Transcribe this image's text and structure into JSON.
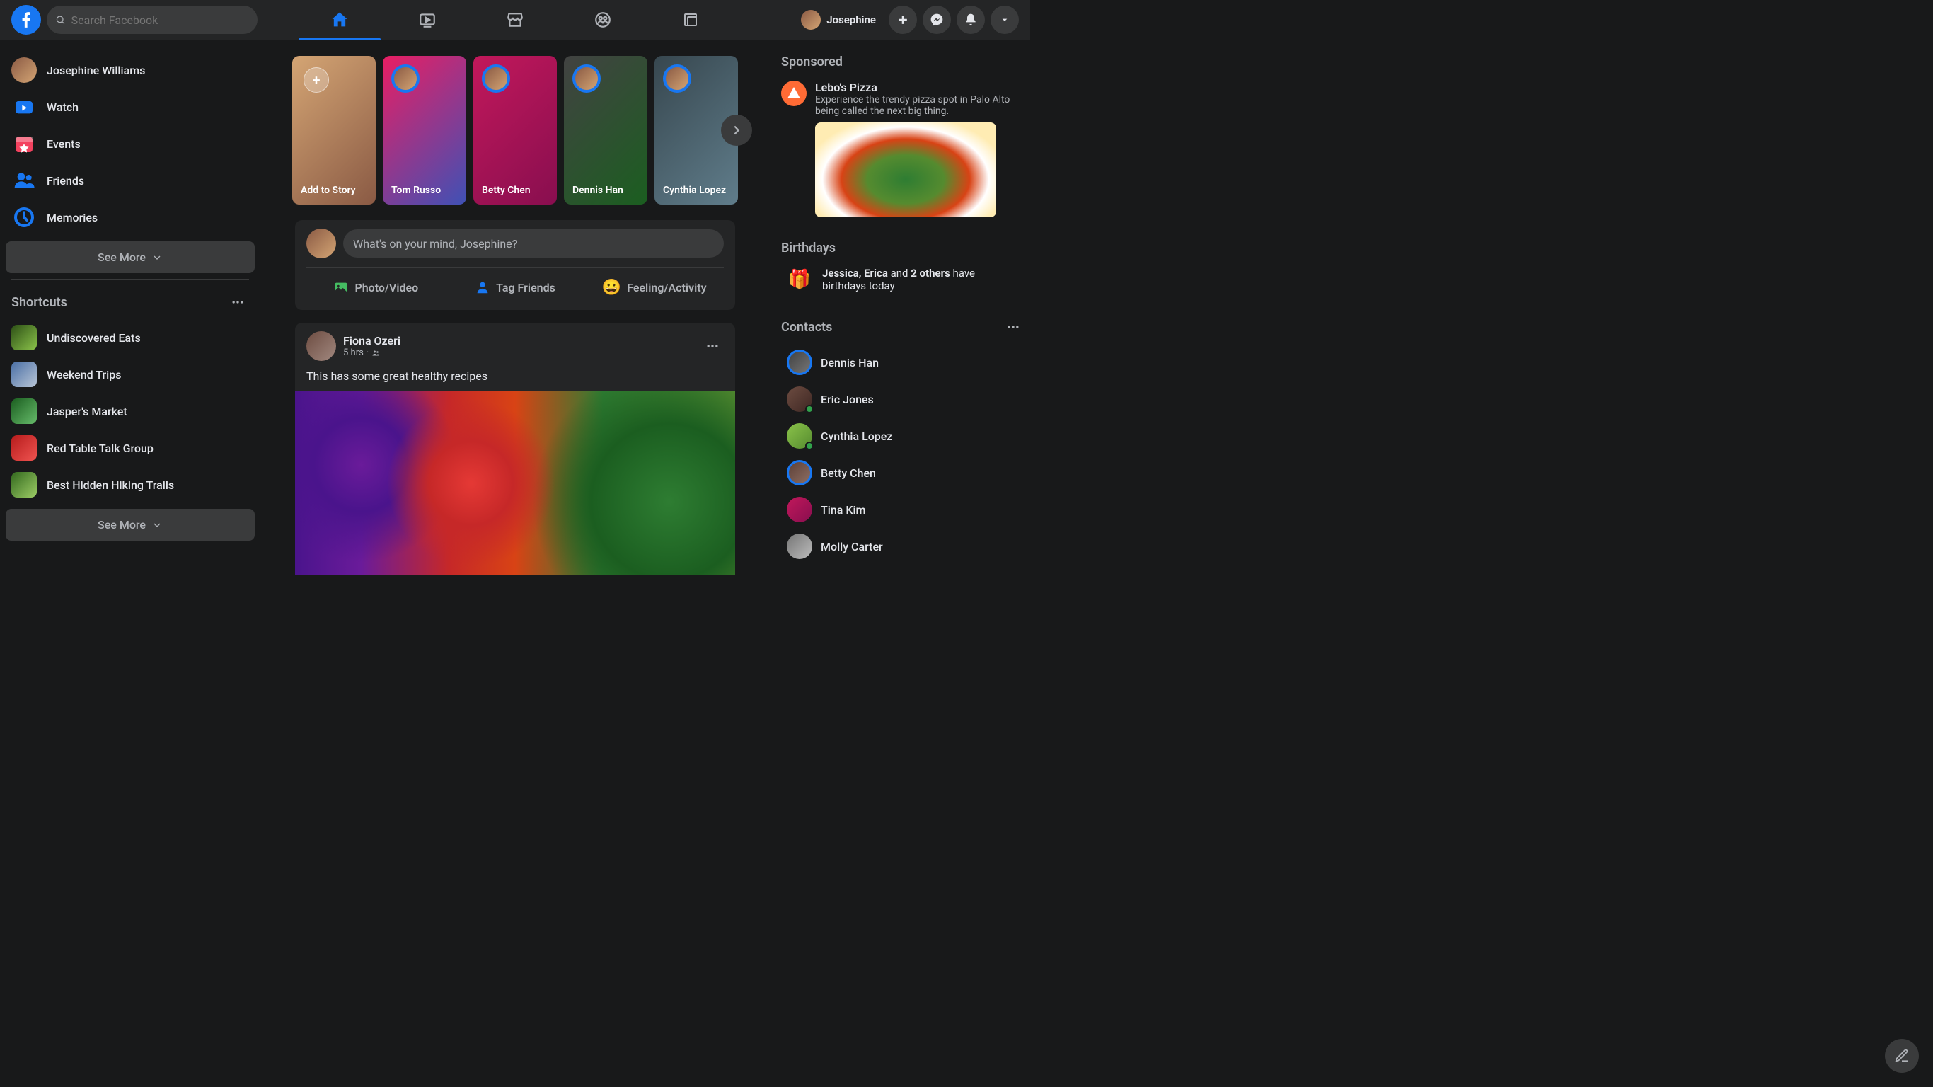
{
  "header": {
    "search_placeholder": "Search Facebook",
    "user_name": "Josephine"
  },
  "left_nav": {
    "profile_name": "Josephine Williams",
    "items": [
      {
        "label": "Watch",
        "icon": "watch",
        "color": "#1877f2"
      },
      {
        "label": "Events",
        "icon": "events",
        "color": "#f3425f"
      },
      {
        "label": "Friends",
        "icon": "friends",
        "color": "#1877f2"
      },
      {
        "label": "Memories",
        "icon": "memories",
        "color": "#1877f2"
      }
    ],
    "see_more": "See More",
    "shortcuts_title": "Shortcuts",
    "shortcuts": [
      {
        "label": "Undiscovered Eats",
        "bg": "linear-gradient(135deg,#2d5016,#8bc34a)"
      },
      {
        "label": "Weekend Trips",
        "bg": "linear-gradient(135deg,#4a6fa5,#b8c5d6)"
      },
      {
        "label": "Jasper's Market",
        "bg": "linear-gradient(135deg,#1b5e20,#66bb6a)"
      },
      {
        "label": "Red Table Talk Group",
        "bg": "linear-gradient(135deg,#b71c1c,#ef5350)"
      },
      {
        "label": "Best Hidden Hiking Trails",
        "bg": "linear-gradient(135deg,#33691e,#9ccc65)"
      }
    ]
  },
  "stories": [
    {
      "label": "Add to Story",
      "type": "add",
      "bg": "linear-gradient(135deg,#d4a574,#8a5a44)"
    },
    {
      "label": "Tom Russo",
      "bg": "linear-gradient(135deg,#e91e63,#3f51b5)"
    },
    {
      "label": "Betty Chen",
      "bg": "linear-gradient(135deg,#c2185b,#880e4f)"
    },
    {
      "label": "Dennis Han",
      "bg": "linear-gradient(135deg,#424242,#1b5e20)"
    },
    {
      "label": "Cynthia Lopez",
      "bg": "linear-gradient(135deg,#37474f,#607d8b)"
    }
  ],
  "composer": {
    "placeholder": "What's on your mind, Josephine?",
    "photo_video": "Photo/Video",
    "tag_friends": "Tag Friends",
    "feeling": "Feeling/Activity"
  },
  "post": {
    "author": "Fiona Ozeri",
    "time": "5 hrs",
    "text": "This has some great healthy recipes"
  },
  "right": {
    "sponsored_title": "Sponsored",
    "sponsor": {
      "title": "Lebo's Pizza",
      "desc": "Experience the trendy pizza spot in Palo Alto being called the next big thing."
    },
    "birthdays_title": "Birthdays",
    "birthday_text_1": "Jessica, Erica",
    "birthday_text_2": " and ",
    "birthday_text_3": "2 others",
    "birthday_text_4": " have birthdays today",
    "contacts_title": "Contacts",
    "contacts": [
      {
        "name": "Dennis Han",
        "ring": true,
        "online": false,
        "bg": "linear-gradient(135deg,#424242,#757575)"
      },
      {
        "name": "Eric Jones",
        "ring": false,
        "online": true,
        "bg": "linear-gradient(135deg,#6d4c41,#3e2723)"
      },
      {
        "name": "Cynthia Lopez",
        "ring": false,
        "online": true,
        "bg": "linear-gradient(135deg,#8bc34a,#558b2f)"
      },
      {
        "name": "Betty Chen",
        "ring": true,
        "online": false,
        "bg": "linear-gradient(135deg,#5d4037,#8d6e63)"
      },
      {
        "name": "Tina Kim",
        "ring": false,
        "online": false,
        "bg": "linear-gradient(135deg,#c2185b,#880e4f)"
      },
      {
        "name": "Molly Carter",
        "ring": false,
        "online": false,
        "bg": "linear-gradient(135deg,#757575,#bdbdbd)"
      }
    ]
  }
}
